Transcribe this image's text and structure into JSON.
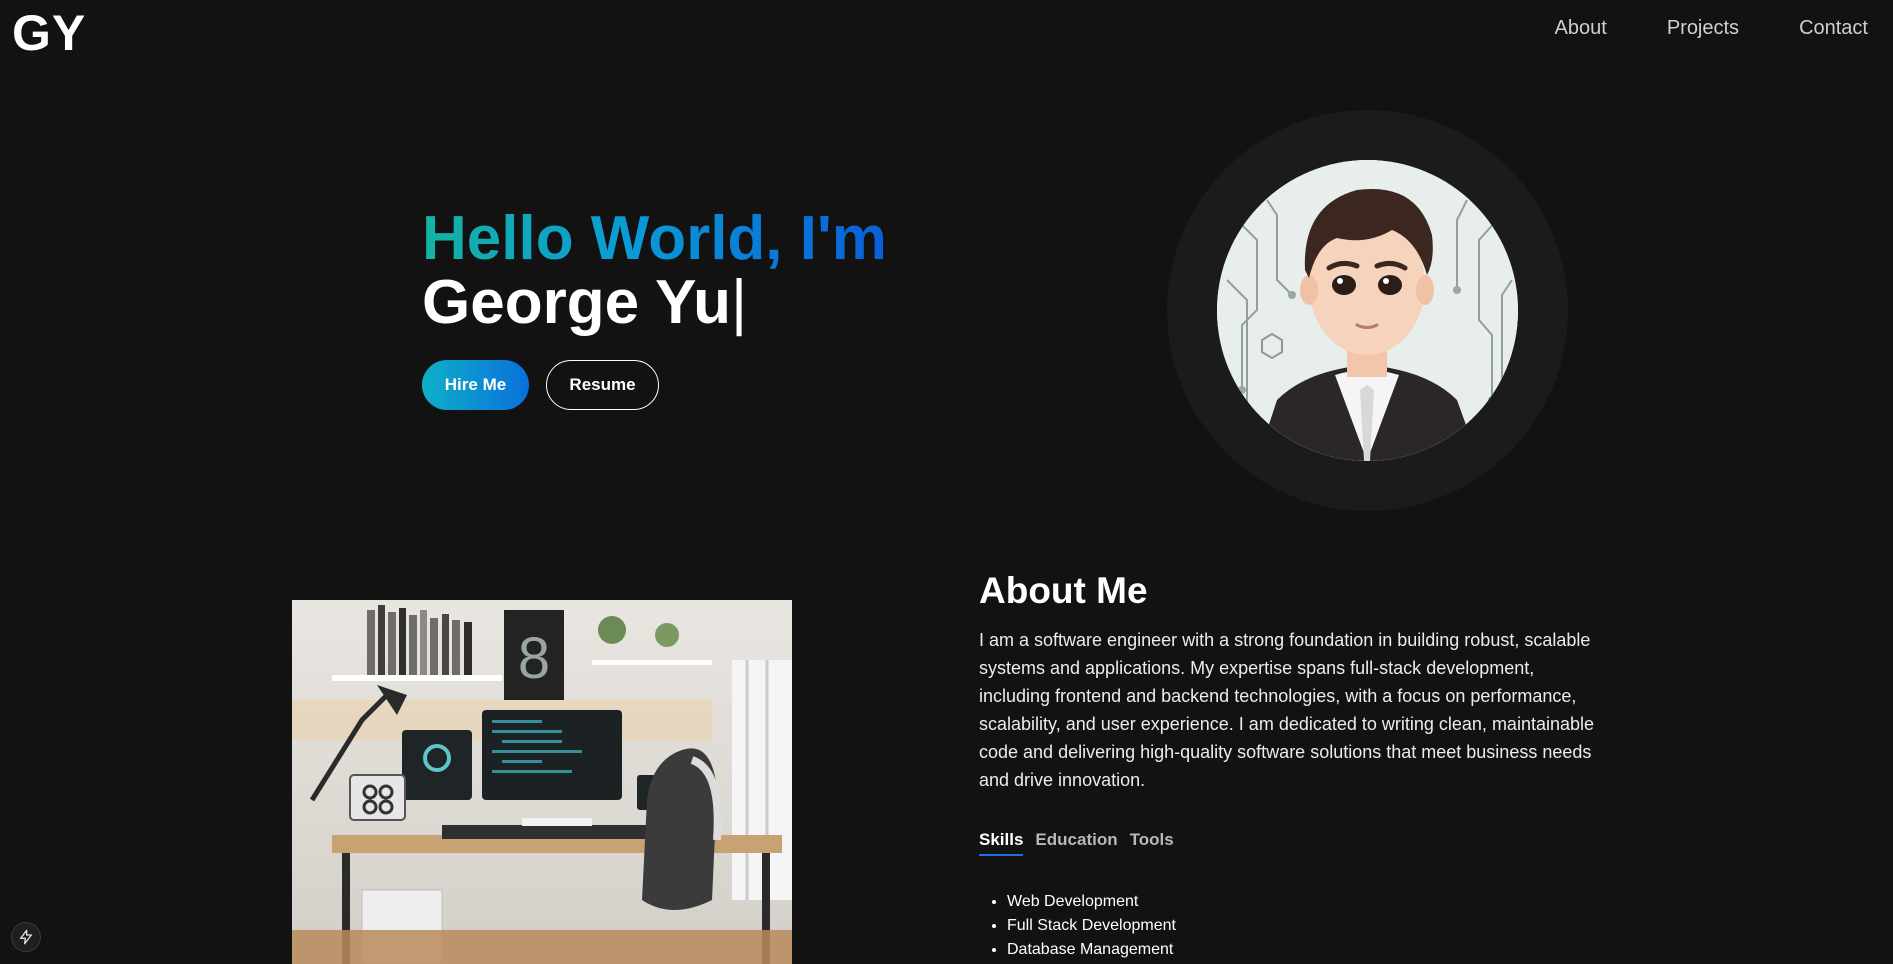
{
  "header": {
    "logo": "GY",
    "nav": [
      {
        "label": "About"
      },
      {
        "label": "Projects"
      },
      {
        "label": "Contact"
      }
    ]
  },
  "hero": {
    "greeting": "Hello World, I'm",
    "name": "George Yu",
    "cursor": "|",
    "hire_label": "Hire Me",
    "resume_label": "Resume",
    "gradient_colors": [
      "#16b3a3",
      "#0a9ad6",
      "#0a5fd8"
    ]
  },
  "about": {
    "title": "About Me",
    "body": "I am a software engineer with a strong foundation in building robust, scalable systems and applications. My expertise spans full-stack development, including frontend and backend technologies, with a focus on performance, scalability, and user experience. I am dedicated to writing clean, maintainable code and delivering high-quality software solutions that meet business needs and drive innovation.",
    "tabs": [
      {
        "label": "Skills",
        "active": true
      },
      {
        "label": "Education",
        "active": false
      },
      {
        "label": "Tools",
        "active": false
      }
    ],
    "skills": [
      "Web Development",
      "Full Stack Development",
      "Database Management"
    ]
  },
  "icons": {
    "avatar": "cartoon-portrait-avatar",
    "workspace": "desk-workspace-photo",
    "bolt": "lightning-bolt-icon"
  },
  "colors": {
    "background": "#121212",
    "accent": "#1f6fe0"
  }
}
